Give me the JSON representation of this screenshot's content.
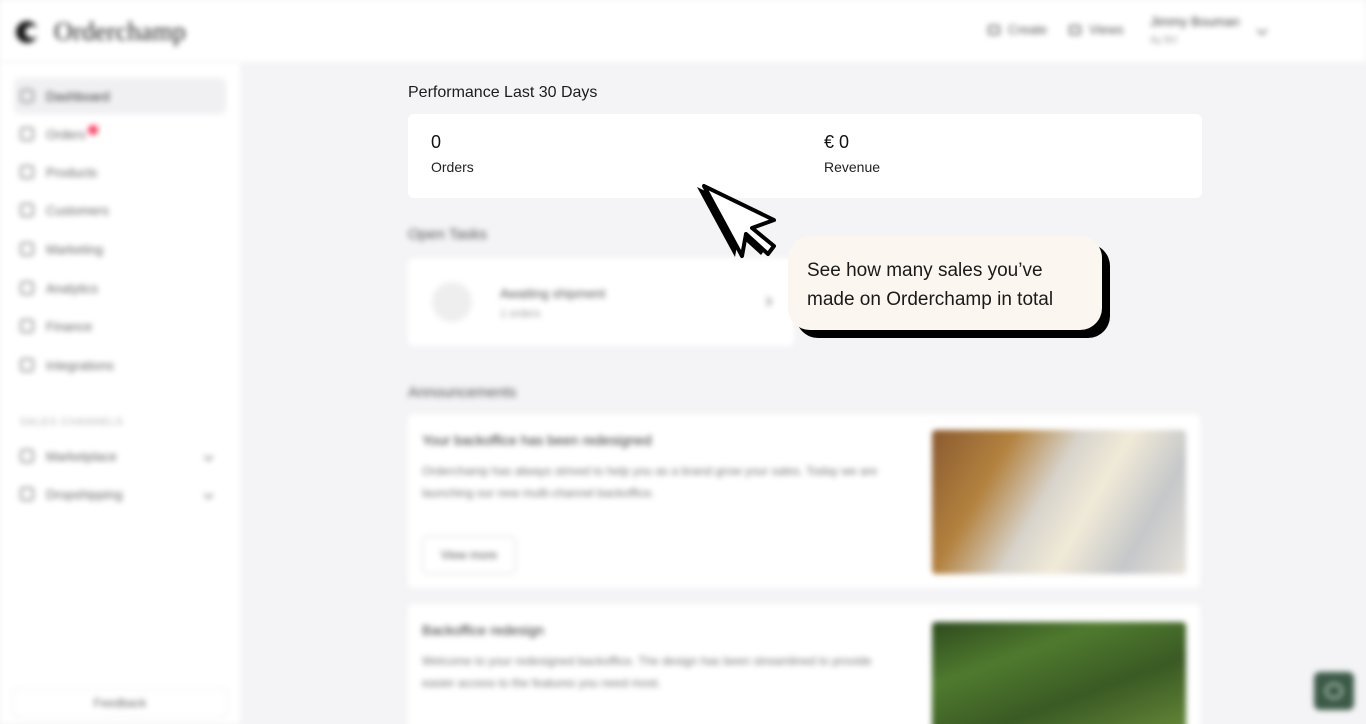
{
  "brand": {
    "name": "Orderchamp"
  },
  "topbar": {
    "create_label": "Create",
    "views_label": "Views",
    "user_name": "Jimmy Bouman",
    "user_sub": "Ay BV",
    "icons": [
      "plus-icon",
      "views-icon",
      "chevron-down-icon"
    ]
  },
  "sidebar": {
    "items": [
      {
        "label": "Dashboard",
        "icon": "home-icon"
      },
      {
        "label": "Orders",
        "icon": "orders-icon"
      },
      {
        "label": "Products",
        "icon": "tag-icon"
      },
      {
        "label": "Customers",
        "icon": "customers-icon"
      },
      {
        "label": "Marketing",
        "icon": "megaphone-icon"
      },
      {
        "label": "Analytics",
        "icon": "chart-icon"
      },
      {
        "label": "Finance",
        "icon": "finance-icon"
      },
      {
        "label": "Integrations",
        "icon": "link-icon"
      }
    ],
    "section_label": "SALES CHANNELS",
    "channels": [
      {
        "label": "Marketplace",
        "icon": "shop-icon"
      },
      {
        "label": "Dropshipping",
        "icon": "dropship-icon"
      }
    ],
    "feedback_label": "Feedback"
  },
  "performance": {
    "title": "Performance Last 30 Days",
    "orders_value": "0",
    "orders_label": "Orders",
    "revenue_value": "€ 0",
    "revenue_label": "Revenue"
  },
  "open_tasks": {
    "title": "Open Tasks",
    "task_title": "Awaiting shipment",
    "task_sub": "1 orders"
  },
  "announcements": {
    "title": "Announcements",
    "items": [
      {
        "title": "Your backoffice has been redesigned",
        "text": "Orderchamp has always strived to help you as a brand grow your sales. Today we are launching our new multi-channel backoffice.",
        "button": "View more"
      },
      {
        "title": "Backoffice redesign",
        "text": "Welcome to your redesigned backoffice. The design has been streamlined to provide easier access to the features you need most."
      }
    ]
  },
  "tooltip": {
    "text": "See how many sales you’ve made on Orderchamp in total"
  },
  "colors": {
    "accent_dark": "#000000",
    "tooltip_bg": "#fcf6f0",
    "badge": "#ff3b5c",
    "chat_button": "#3c5a48"
  }
}
